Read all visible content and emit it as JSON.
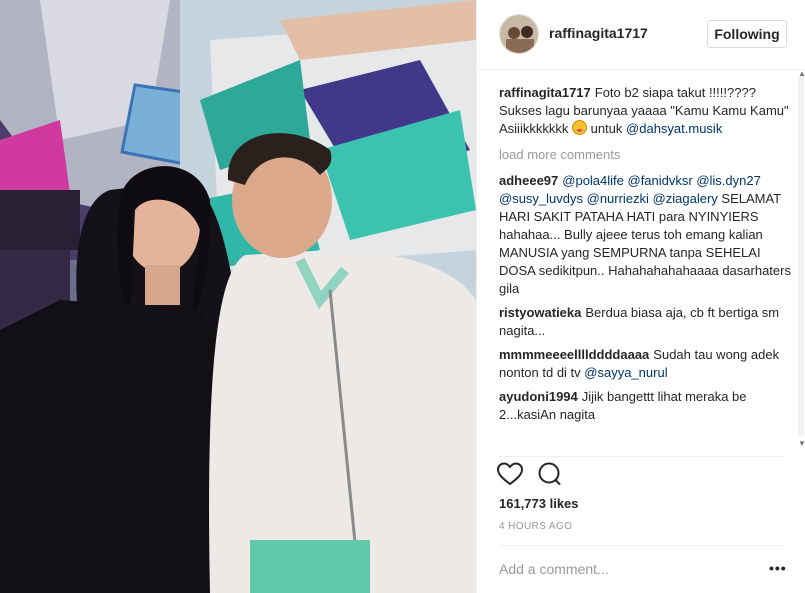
{
  "post": {
    "username": "raffinagita1717",
    "follow_label": "Following",
    "likes": "161,773 likes",
    "timestamp": "4 HOURS AGO",
    "add_comment_placeholder": "Add a comment...",
    "more_label": "•••"
  },
  "caption": {
    "username": "raffinagita1717",
    "text1": "Foto b2 siapa takut !!!!!???? Sukses lagu barunyaa yaaaa \"Kamu Kamu Kamu\" Asiiikkkkkkk",
    "text2": "untuk",
    "mention": "@dahsyat.musik"
  },
  "load_more": "load more comments",
  "comments": [
    {
      "username": "adheee97",
      "mentions": "@pola4life @fanidvksr @lis.dyn27 @susy_luvdys @nurriezki @ziagalery",
      "text": "SELAMAT HARI SAKIT PATAHA HATI para NYINYIERS hahahaa... Bully ajeee terus toh emang kalian MANUSIA yang SEMPURNA tanpa SEHELAI DOSA sedikitpun.. Hahahahahahaaaa dasarhaters gila"
    },
    {
      "username": "ristyowatieka",
      "text": "Berdua biasa aja, cb ft bertiga sm nagita..."
    },
    {
      "username": "mmmmeeeellllddddaaaa",
      "text": "Sudah tau wong adek nonton td di tv",
      "mention": "@sayya_nurul"
    },
    {
      "username": "ayudoni1994",
      "text": "Jijik bangettt lihat meraka be 2...kasiAn nagita"
    }
  ],
  "colors": {
    "link": "#003569",
    "muted": "#999999",
    "text": "#262626",
    "like_icon": "heart-icon",
    "comment_icon": "comment-bubble-icon"
  }
}
